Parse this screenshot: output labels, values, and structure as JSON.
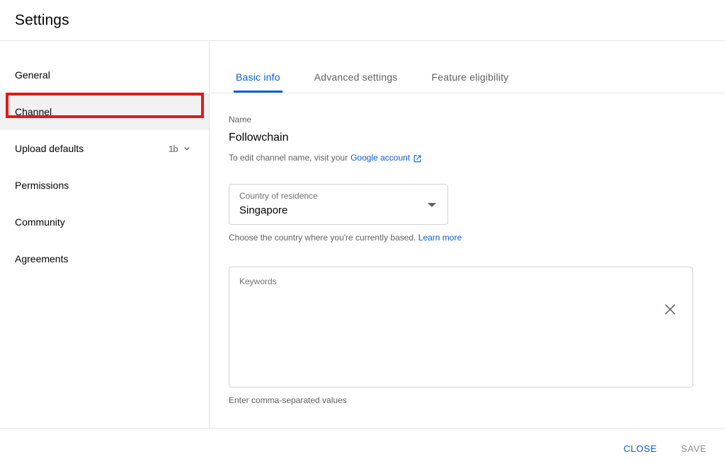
{
  "header": {
    "title": "Settings"
  },
  "sidebar": {
    "items": [
      {
        "label": "General",
        "selected": false,
        "badge": "",
        "has_chevron": false
      },
      {
        "label": "Channel",
        "selected": true,
        "badge": "",
        "has_chevron": false
      },
      {
        "label": "Upload defaults",
        "selected": false,
        "badge": "1b",
        "has_chevron": true
      },
      {
        "label": "Permissions",
        "selected": false,
        "badge": "",
        "has_chevron": false
      },
      {
        "label": "Community",
        "selected": false,
        "badge": "",
        "has_chevron": false
      },
      {
        "label": "Agreements",
        "selected": false,
        "badge": "",
        "has_chevron": false
      }
    ]
  },
  "annotation": {
    "color": "#e01b1b",
    "target": "Channel"
  },
  "tabs": [
    {
      "label": "Basic info",
      "active": true
    },
    {
      "label": "Advanced settings",
      "active": false
    },
    {
      "label": "Feature eligibility",
      "active": false
    }
  ],
  "main": {
    "name": {
      "caption": "Name",
      "value": "Followchain",
      "hint_prefix": "To edit channel name, visit your",
      "hint_link": "Google account"
    },
    "country": {
      "label": "Country of residence",
      "value": "Singapore",
      "helper_prefix": "Choose the country where you're currently based.",
      "helper_link": "Learn more"
    },
    "keywords": {
      "label": "Keywords",
      "value": "",
      "placeholder": "",
      "helper": "Enter comma-separated values"
    }
  },
  "footer": {
    "close_label": "CLOSE",
    "save_label": "SAVE"
  },
  "colors": {
    "accent": "#065fd4",
    "annotation": "#e01b1b",
    "selected_row": "#f2f2f2",
    "divider": "#e5e5e5"
  }
}
